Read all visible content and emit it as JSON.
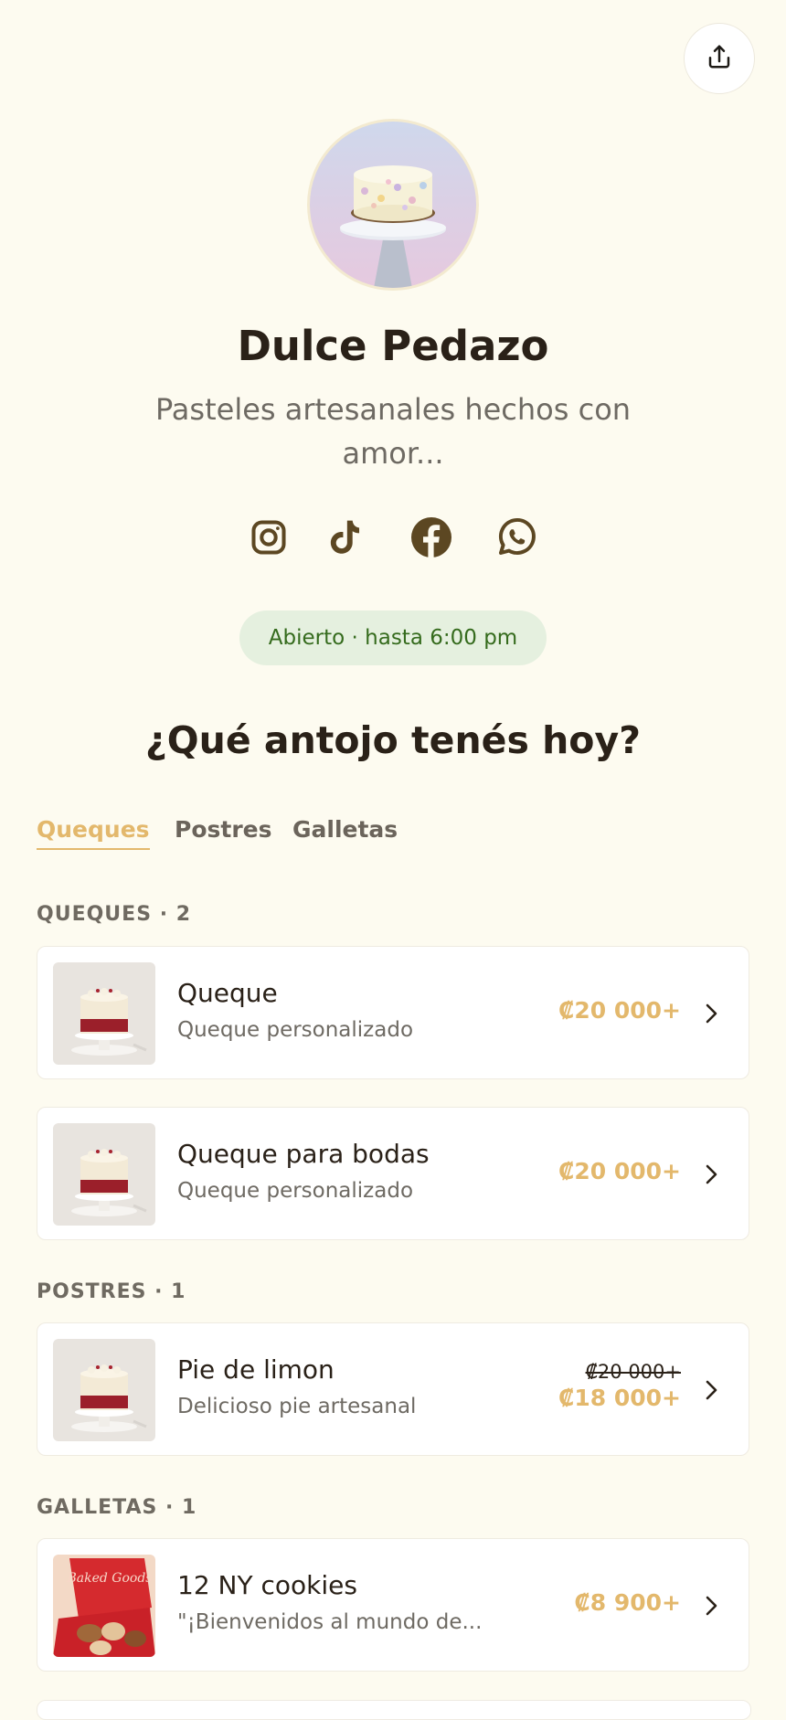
{
  "store": {
    "name": "Dulce Pedazo",
    "tagline": "Pasteles artesanales hechos con amor...",
    "status": "Abierto · hasta 6:00 pm"
  },
  "socials": [
    {
      "icon": "instagram-icon"
    },
    {
      "icon": "tiktok-icon"
    },
    {
      "icon": "facebook-icon"
    },
    {
      "icon": "whatsapp-icon"
    }
  ],
  "heading": "¿Qué antojo tenés hoy?",
  "tabs": [
    {
      "label": "Queques",
      "active": true
    },
    {
      "label": "Postres",
      "active": false
    },
    {
      "label": "Galletas",
      "active": false
    }
  ],
  "sections": [
    {
      "label": "QUEQUES · 2",
      "items": [
        {
          "title": "Queque",
          "subtitle": "Queque personalizado",
          "price": "₡20 000+"
        },
        {
          "title": "Queque para bodas",
          "subtitle": "Queque personalizado",
          "price": "₡20 000+"
        }
      ]
    },
    {
      "label": "POSTRES · 1",
      "items": [
        {
          "title": "Pie de limon",
          "subtitle": "Delicioso pie artesanal",
          "price_old": "₡20 000+",
          "price": "₡18 000+"
        }
      ]
    },
    {
      "label": "GALLETAS · 1",
      "items": [
        {
          "title": "12 NY cookies",
          "subtitle": "\"¡Bienvenidos al mundo de...",
          "price": "₡8 900+",
          "image_text": "Baked Goods"
        }
      ]
    }
  ],
  "colors": {
    "background": "#fdfbf0",
    "accent": "#e3b86c",
    "icon": "#5c4722",
    "status_bg": "#e5f0df",
    "status_text": "#356b1d"
  }
}
